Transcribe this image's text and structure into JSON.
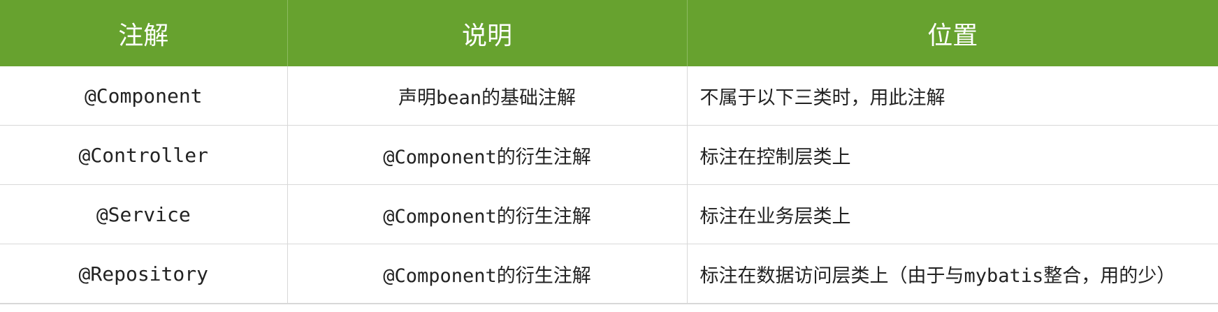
{
  "table": {
    "headers": [
      "注解",
      "说明",
      "位置"
    ],
    "rows": [
      {
        "annotation": "@Component",
        "description": "声明bean的基础注解",
        "position": "不属于以下三类时，用此注解"
      },
      {
        "annotation": "@Controller",
        "description": "@Component的衍生注解",
        "position": "标注在控制层类上"
      },
      {
        "annotation": "@Service",
        "description": "@Component的衍生注解",
        "position": "标注在业务层类上"
      },
      {
        "annotation": "@Repository",
        "description": "@Component的衍生注解",
        "position": "标注在数据访问层类上（由于与mybatis整合，用的少）"
      }
    ]
  },
  "colors": {
    "header_background": "#67a22f",
    "header_text": "#ffffff",
    "grid_line": "#d8d8d8"
  }
}
